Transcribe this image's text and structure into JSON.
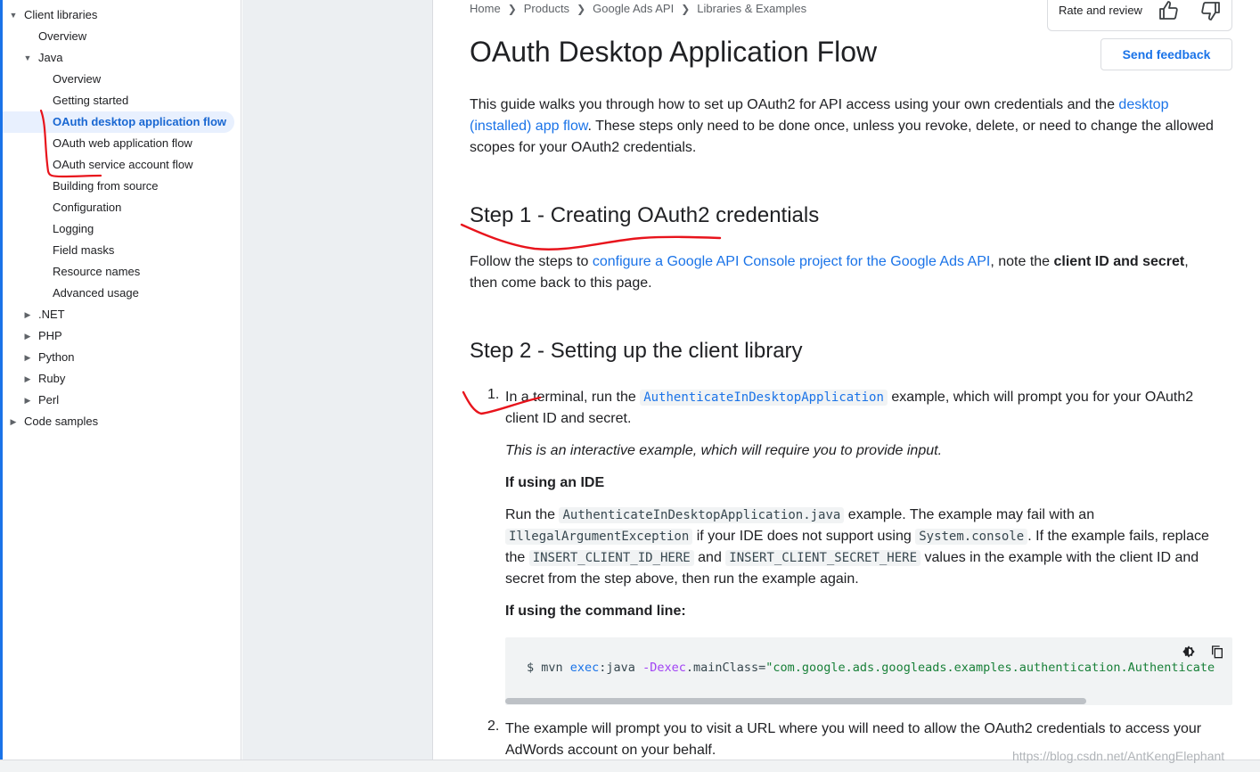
{
  "sidebar": {
    "items": [
      {
        "label": "Client libraries",
        "expanded": true
      },
      {
        "label": "Overview"
      },
      {
        "label": "Java",
        "expanded": true
      },
      {
        "label": "Overview"
      },
      {
        "label": "Getting started"
      },
      {
        "label": "OAuth desktop application flow",
        "active": true
      },
      {
        "label": "OAuth web application flow"
      },
      {
        "label": "OAuth service account flow"
      },
      {
        "label": "Building from source"
      },
      {
        "label": "Configuration"
      },
      {
        "label": "Logging"
      },
      {
        "label": "Field masks"
      },
      {
        "label": "Resource names"
      },
      {
        "label": "Advanced usage"
      },
      {
        "label": ".NET",
        "expanded": false
      },
      {
        "label": "PHP",
        "expanded": false
      },
      {
        "label": "Python",
        "expanded": false
      },
      {
        "label": "Ruby",
        "expanded": false
      },
      {
        "label": "Perl",
        "expanded": false
      },
      {
        "label": "Code samples",
        "expanded": false
      }
    ]
  },
  "breadcrumb": [
    "Home",
    "Products",
    "Google Ads API",
    "Libraries & Examples"
  ],
  "rate": {
    "label": "Rate and review",
    "thumbs_up_icon": "thumbs-up-icon",
    "thumbs_down_icon": "thumbs-down-icon"
  },
  "feedback_label": "Send feedback",
  "title": "OAuth Desktop Application Flow",
  "intro": {
    "before": "This guide walks you through how to set up OAuth2 for API access using your own credentials and the ",
    "link": "desktop (installed) app flow",
    "after": ". These steps only need to be done once, unless you revoke, delete, or need to change the allowed scopes for your OAuth2 credentials."
  },
  "step1": {
    "heading": "Step 1 - Creating OAuth2 credentials",
    "before": "Follow the steps to ",
    "link": "configure a Google API Console project for the Google Ads API",
    "middle": ", note the ",
    "bold": "client ID and secret",
    "after": ", then come back to this page."
  },
  "step2": {
    "heading": "Step 2 - Setting up the client library",
    "item1": {
      "number": "1.",
      "before": "In a terminal, run the ",
      "code": "AuthenticateInDesktopApplication",
      "after": " example, which will prompt you for your OAuth2 client ID and secret.",
      "note": "This is an interactive example, which will require you to provide input.",
      "ide_heading": "If using an IDE",
      "ide_p1": "Run the ",
      "ide_code1": "AuthenticateInDesktopApplication.java",
      "ide_p2": " example. The example may fail with an ",
      "ide_code2": "IllegalArgumentException",
      "ide_p3": " if your IDE does not support using ",
      "ide_code3": "System.console",
      "ide_p4": ". If the example fails, replace the ",
      "ide_code4": "INSERT_CLIENT_ID_HERE",
      "ide_p5": " and ",
      "ide_code5": "INSERT_CLIENT_SECRET_HERE",
      "ide_p6": " values in the example with the client ID and secret from the step above, then run the example again.",
      "cli_heading": "If using the command line:"
    },
    "code": {
      "prompt": "$ mvn ",
      "exec": "exec",
      "java": ":java ",
      "flag": "-Dexec",
      "main": ".mainClass=",
      "str": "\"com.google.ads.googleads.examples.authentication.Authenticate",
      "theme_icon": "dark-mode-icon",
      "copy_icon": "copy-icon"
    },
    "item2": {
      "number": "2.",
      "text": "The example will prompt you to visit a URL where you will need to allow the OAuth2 credentials to access your AdWords account on your behalf."
    }
  },
  "watermark": "https://blog.csdn.net/AntKengElephant",
  "colors": {
    "accent": "#1a73e8",
    "annotation": "#e8141c"
  }
}
